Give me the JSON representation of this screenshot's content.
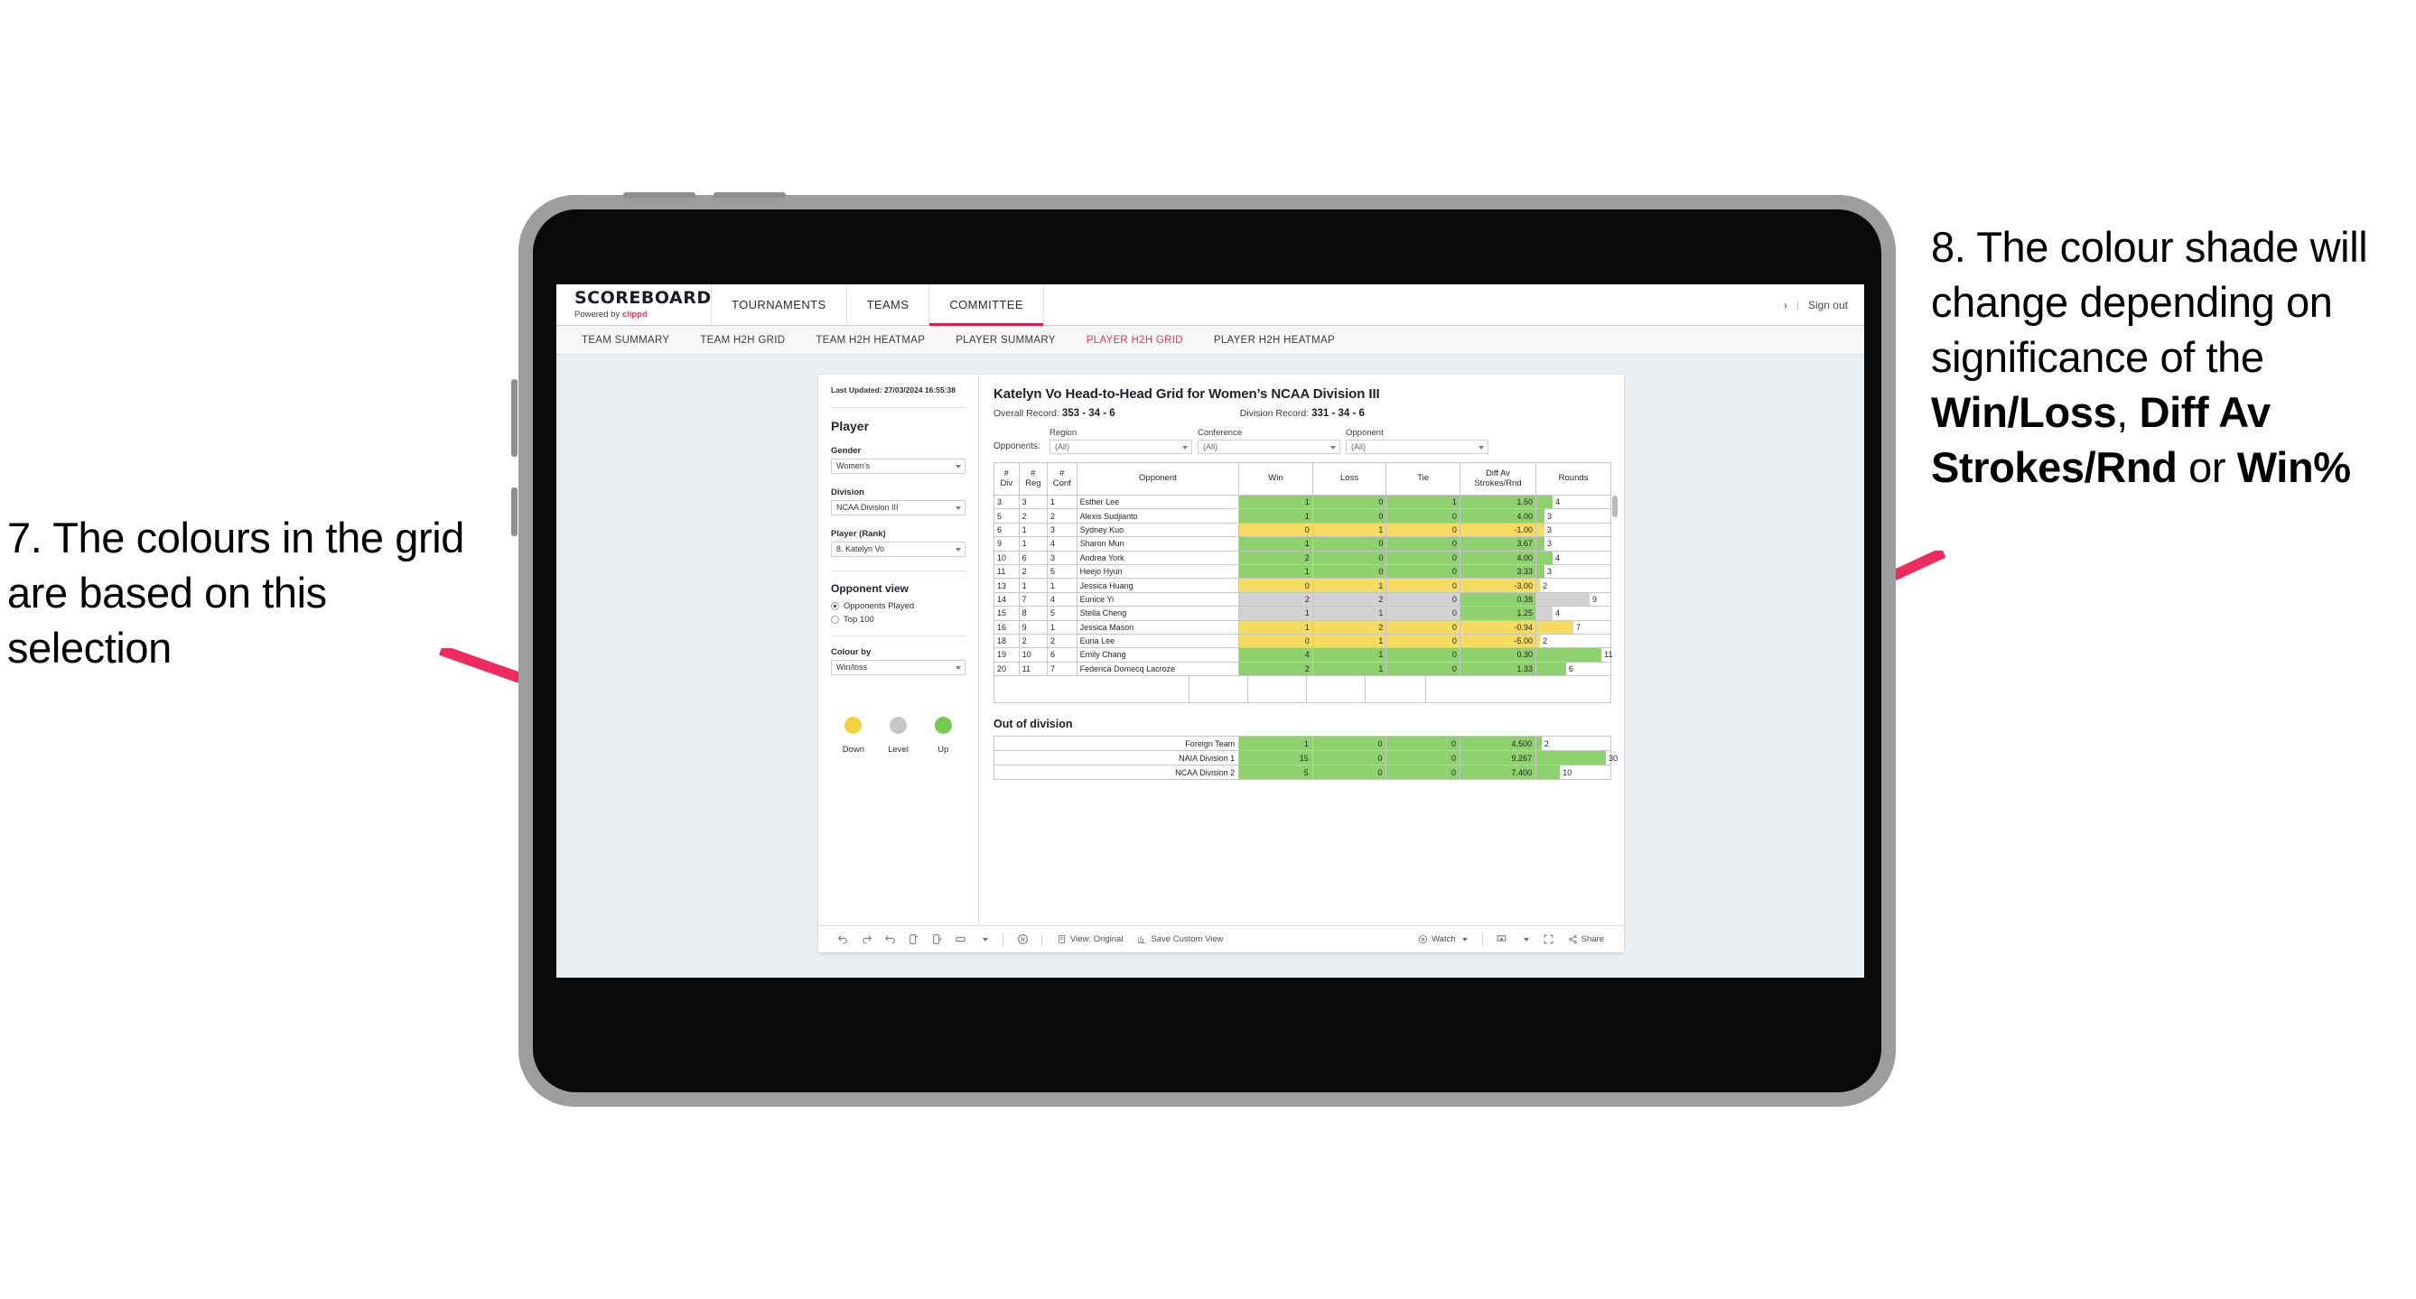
{
  "annotations": {
    "left": "7. The colours in the grid are based on this selection",
    "right_parts": [
      {
        "text": "8. The colour shade will change depending on significance of the ",
        "bold": false
      },
      {
        "text": "Win/Loss",
        "bold": true
      },
      {
        "text": ", ",
        "bold": false
      },
      {
        "text": "Diff Av Strokes/Rnd",
        "bold": true
      },
      {
        "text": " or ",
        "bold": false
      },
      {
        "text": "Win%",
        "bold": true
      }
    ],
    "arrow_color": "#ee2b5e"
  },
  "brand": {
    "title": "SCOREBOARD",
    "powered_prefix": "Powered by ",
    "powered_name": "clippd"
  },
  "topnav": {
    "items": [
      {
        "label": "TOURNAMENTS",
        "active": false
      },
      {
        "label": "TEAMS",
        "active": false
      },
      {
        "label": "COMMITTEE",
        "active": true
      }
    ],
    "chevron": "›",
    "separator": "|",
    "sign_out": "Sign out"
  },
  "subnav": {
    "items": [
      {
        "label": "TEAM SUMMARY",
        "active": false
      },
      {
        "label": "TEAM H2H GRID",
        "active": false
      },
      {
        "label": "TEAM H2H HEATMAP",
        "active": false
      },
      {
        "label": "PLAYER SUMMARY",
        "active": false
      },
      {
        "label": "PLAYER H2H GRID",
        "active": true
      },
      {
        "label": "PLAYER H2H HEATMAP",
        "active": false
      }
    ],
    "active_color": "#e0365c"
  },
  "panel": {
    "last_updated": "Last Updated: 27/03/2024 16:55:38",
    "heading": "Player",
    "fields": [
      {
        "label": "Gender",
        "value": "Women’s"
      },
      {
        "label": "Division",
        "value": "NCAA Division III"
      },
      {
        "label": "Player (Rank)",
        "value": "8. Katelyn Vo"
      }
    ],
    "opponent_view": {
      "heading": "Opponent view",
      "options": [
        {
          "label": "Opponents Played",
          "selected": true
        },
        {
          "label": "Top 100",
          "selected": false
        }
      ]
    },
    "colour_by": {
      "label": "Colour by",
      "value": "Win/loss"
    },
    "legend": [
      {
        "label": "Down",
        "color": "#f2d23f"
      },
      {
        "label": "Level",
        "color": "#c4c6c8"
      },
      {
        "label": "Up",
        "color": "#76c94f"
      }
    ]
  },
  "main": {
    "title": "Katelyn Vo Head-to-Head Grid for Women’s NCAA Division III",
    "overall_record_label": "Overall Record: ",
    "overall_record_value": "353 - 34 - 6",
    "division_record_label": "Division Record: ",
    "division_record_value": "331 - 34 - 6",
    "opponents_label": "Opponents:",
    "opponent_filters": [
      {
        "label": "Region",
        "value": "(All)"
      },
      {
        "label": "Conference",
        "value": "(All)"
      },
      {
        "label": "Opponent",
        "value": "(All)"
      }
    ],
    "columns": [
      "# Div",
      "# Reg",
      "# Conf",
      "Opponent",
      "Win",
      "Loss",
      "Tie",
      "Diff Av Strokes/Rnd",
      "Rounds"
    ],
    "column_lines": [
      [
        "#",
        "Div"
      ],
      [
        "#",
        "Reg"
      ],
      [
        "#",
        "Conf"
      ],
      [
        "Opponent"
      ],
      [
        "Win"
      ],
      [
        "Loss"
      ],
      [
        "Tie"
      ],
      [
        "Diff Av",
        "Strokes/Rnd"
      ],
      [
        "Rounds"
      ]
    ],
    "out_of_division_title": "Out of division",
    "out_of_division": [
      {
        "name": "Foreign Team",
        "win": "1",
        "loss": "0",
        "tie": "0",
        "diff": "4.500",
        "rounds": "2",
        "state": "up",
        "bar_pct": 7
      },
      {
        "name": "NAIA Division 1",
        "win": "15",
        "loss": "0",
        "tie": "0",
        "diff": "9.267",
        "rounds": "30",
        "state": "up",
        "bar_pct": 94
      },
      {
        "name": "NCAA Division 2",
        "win": "5",
        "loss": "0",
        "tie": "0",
        "diff": "7.400",
        "rounds": "10",
        "state": "up",
        "bar_pct": 32
      }
    ]
  },
  "toolbar": {
    "view_label": "View: Original",
    "save_label": "Save Custom View",
    "watch_label": "Watch",
    "share_label": "Share"
  },
  "chart_data": {
    "type": "table",
    "title": "Katelyn Vo Head-to-Head Grid for Women’s NCAA Division III",
    "columns": [
      "# Div",
      "# Reg",
      "# Conf",
      "Opponent",
      "Win",
      "Loss",
      "Tie",
      "Diff Av Strokes/Rnd",
      "Rounds"
    ],
    "colour_scale": {
      "up": "#8fd16e",
      "down": "#f5dc60",
      "level": "#d2d2d2",
      "none": "#ffffff"
    },
    "rows": [
      {
        "div": "3",
        "reg": "3",
        "conf": "1",
        "opponent": "Esther Lee",
        "win": "1",
        "loss": "0",
        "tie": "1",
        "diff": "1.50",
        "rounds": "4",
        "state": "up",
        "bar_pct": 22
      },
      {
        "div": "5",
        "reg": "2",
        "conf": "2",
        "opponent": "Alexis Sudjianto",
        "win": "1",
        "loss": "0",
        "tie": "0",
        "diff": "4.00",
        "rounds": "3",
        "state": "up",
        "bar_pct": 11
      },
      {
        "div": "6",
        "reg": "1",
        "conf": "3",
        "opponent": "Sydney Kuo",
        "win": "0",
        "loss": "1",
        "tie": "0",
        "diff": "-1.00",
        "rounds": "3",
        "state": "down",
        "bar_pct": 11
      },
      {
        "div": "9",
        "reg": "1",
        "conf": "4",
        "opponent": "Sharon Mun",
        "win": "1",
        "loss": "0",
        "tie": "0",
        "diff": "3.67",
        "rounds": "3",
        "state": "up",
        "bar_pct": 11
      },
      {
        "div": "10",
        "reg": "6",
        "conf": "3",
        "opponent": "Andrea York",
        "win": "2",
        "loss": "0",
        "tie": "0",
        "diff": "4.00",
        "rounds": "4",
        "state": "up",
        "bar_pct": 22
      },
      {
        "div": "11",
        "reg": "2",
        "conf": "5",
        "opponent": "Heejo Hyun",
        "win": "1",
        "loss": "0",
        "tie": "0",
        "diff": "3.33",
        "rounds": "3",
        "state": "up",
        "bar_pct": 11
      },
      {
        "div": "13",
        "reg": "1",
        "conf": "1",
        "opponent": "Jessica Huang",
        "win": "0",
        "loss": "1",
        "tie": "0",
        "diff": "-3.00",
        "rounds": "2",
        "state": "down",
        "bar_pct": 5
      },
      {
        "div": "14",
        "reg": "7",
        "conf": "4",
        "opponent": "Eunice Yi",
        "win": "2",
        "loss": "2",
        "tie": "0",
        "diff": "0.38",
        "rounds": "9",
        "state": "level",
        "diff_state": "up",
        "bar_pct": 72
      },
      {
        "div": "15",
        "reg": "8",
        "conf": "5",
        "opponent": "Stella Cheng",
        "win": "1",
        "loss": "1",
        "tie": "0",
        "diff": "1.25",
        "rounds": "4",
        "state": "level",
        "diff_state": "up",
        "bar_pct": 22
      },
      {
        "div": "16",
        "reg": "9",
        "conf": "1",
        "opponent": "Jessica Mason",
        "win": "1",
        "loss": "2",
        "tie": "0",
        "diff": "-0.94",
        "rounds": "7",
        "state": "down",
        "bar_pct": 50
      },
      {
        "div": "18",
        "reg": "2",
        "conf": "2",
        "opponent": "Euna Lee",
        "win": "0",
        "loss": "1",
        "tie": "0",
        "diff": "-5.00",
        "rounds": "2",
        "state": "down",
        "bar_pct": 5
      },
      {
        "div": "19",
        "reg": "10",
        "conf": "6",
        "opponent": "Emily Chang",
        "win": "4",
        "loss": "1",
        "tie": "0",
        "diff": "0.30",
        "rounds": "11",
        "state": "up",
        "bar_pct": 88
      },
      {
        "div": "20",
        "reg": "11",
        "conf": "7",
        "opponent": "Federica Domecq Lacroze",
        "win": "2",
        "loss": "1",
        "tie": "0",
        "diff": "1.33",
        "rounds": "6",
        "state": "up",
        "bar_pct": 40
      }
    ]
  }
}
